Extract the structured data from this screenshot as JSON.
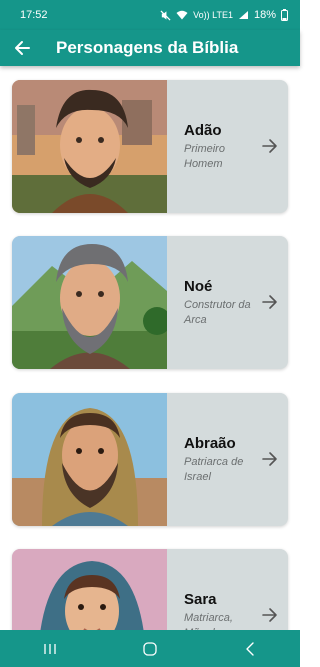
{
  "status_bar": {
    "time": "17:52",
    "network_label": "Vo)) LTE1",
    "battery": "18%"
  },
  "app_bar": {
    "title": "Personagens da Bíblia",
    "back_icon": "arrow-left-icon"
  },
  "characters": [
    {
      "name": "Adão",
      "description": "Primeiro Homem"
    },
    {
      "name": "Noé",
      "description": "Construtor da Arca"
    },
    {
      "name": "Abraão",
      "description": "Patriarca de Israel"
    },
    {
      "name": "Sara",
      "description": "Matriarca, Mãe de"
    }
  ],
  "nav_bar": {
    "recent_icon": "recent-apps-icon",
    "home_icon": "home-icon",
    "back_icon": "back-icon"
  },
  "colors": {
    "primary": "#15968a",
    "card": "#d4dbdc",
    "text": "#111111",
    "subtext": "#6b6f70"
  }
}
